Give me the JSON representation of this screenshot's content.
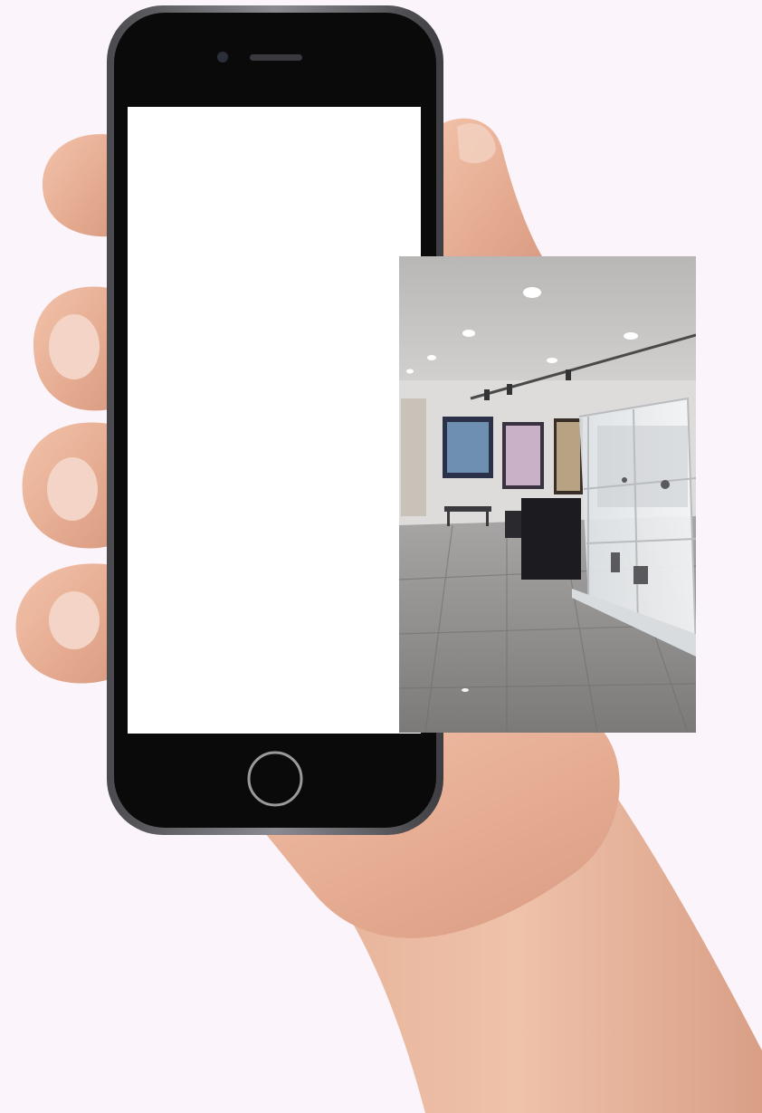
{
  "scene": {
    "background_color": "#fbf4fa",
    "skin_color": "#e9b59c",
    "phone_frame_color": "#1a1a1c",
    "phone_bezel_color": "#0a0a0a",
    "phone_edge_color": "#6b6b70",
    "screen_color": "#ffffff",
    "home_button_ring_color": "#9a9a9e",
    "photo_subject": "gallery-interior",
    "wall_color": "#d8d6d4",
    "ceiling_color": "#c9c7c5",
    "floor_color": "#8d8b8a",
    "cabinet_glass_color": "#e8eaec",
    "bench_color": "#1c1c20"
  },
  "icons": {
    "phone": "smartphone-icon",
    "home_button": "home-button-icon",
    "camera": "front-camera-icon",
    "speaker": "earpiece-speaker-icon"
  }
}
